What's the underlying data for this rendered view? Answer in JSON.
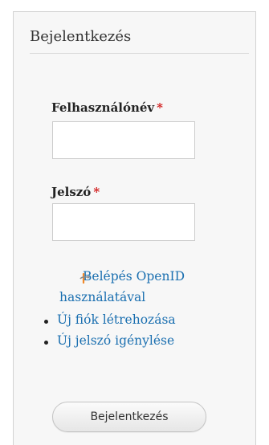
{
  "login_block": {
    "title": "Bejelentkezés",
    "username": {
      "label": "Felhasználónév",
      "required_marker": "*",
      "value": "",
      "placeholder": ""
    },
    "password": {
      "label": "Jelszó",
      "required_marker": "*",
      "value": "",
      "placeholder": ""
    },
    "openid_link": {
      "line1": "Belépés OpenID",
      "line2": "használatával",
      "icon": "openid-icon"
    },
    "links": [
      {
        "label": "Új fiók létrehozása"
      },
      {
        "label": "Új jelszó igénylése"
      }
    ],
    "submit_label": "Bejelentkezés"
  },
  "colors": {
    "link": "#1a6fb0",
    "required": "#d11a1a",
    "block_bg": "#f7f7f7"
  }
}
